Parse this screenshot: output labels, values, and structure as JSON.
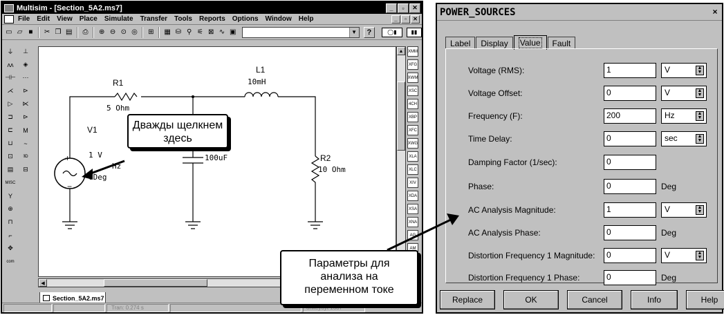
{
  "multisim": {
    "title": "Multisim - [Section_5A2.ms7]",
    "menu": [
      "File",
      "Edit",
      "View",
      "Place",
      "Simulate",
      "Transfer",
      "Tools",
      "Reports",
      "Options",
      "Window",
      "Help"
    ],
    "help_label": "?",
    "doc_tab": "Section_5A2.ms7",
    "status_tran": "Tran: 0.274 s",
    "status_partial": "onkeyoyt 1687",
    "circuit": {
      "r1_name": "R1",
      "r1_value": "5 Ohm",
      "l1_name": "L1",
      "l1_value": "10mH",
      "v1_name": "V1",
      "v1_amp": "1 V",
      "v1_freq": "Hz",
      "v1_phase": "0Deg",
      "r2_name": "R2",
      "r2_value": "10 Ohm",
      "c_value_partial": "100uF"
    }
  },
  "callouts": {
    "double_click": "Дважды щелкнем здесь",
    "ac_params_l1": "Параметры для",
    "ac_params_l2": "анализа на",
    "ac_params_l3": "переменном токе"
  },
  "dialog": {
    "title": "POWER_SOURCES",
    "close_label": "×",
    "tabs": [
      "Label",
      "Display",
      "Value",
      "Fault"
    ],
    "active_tab": "Value",
    "rows": [
      {
        "label": "Voltage (RMS):",
        "value": "1",
        "unit": "V",
        "unit_type": "select"
      },
      {
        "label": "Voltage Offset:",
        "value": "0",
        "unit": "V",
        "unit_type": "select"
      },
      {
        "label": "Frequency (F):",
        "value": "200",
        "unit": "Hz",
        "unit_type": "select"
      },
      {
        "label": "Time Delay:",
        "value": "0",
        "unit": "sec",
        "unit_type": "select"
      },
      {
        "label": "Damping Factor (1/sec):",
        "value": "0",
        "unit": "",
        "unit_type": "none"
      },
      {
        "label": "Phase:",
        "value": "0",
        "unit": "Deg",
        "unit_type": "text"
      },
      {
        "label": "AC Analysis Magnitude:",
        "value": "1",
        "unit": "V",
        "unit_type": "select"
      },
      {
        "label": "AC Analysis Phase:",
        "value": "0",
        "unit": "Deg",
        "unit_type": "text"
      },
      {
        "label": "Distortion Frequency 1 Magnitude:",
        "value": "0",
        "unit": "V",
        "unit_type": "select"
      },
      {
        "label": "Distortion Frequency 1 Phase:",
        "value": "0",
        "unit": "Deg",
        "unit_type": "text"
      }
    ],
    "buttons": {
      "replace": "Replace",
      "ok": "OK",
      "cancel": "Cancel",
      "info": "Info",
      "help": "Help"
    }
  }
}
